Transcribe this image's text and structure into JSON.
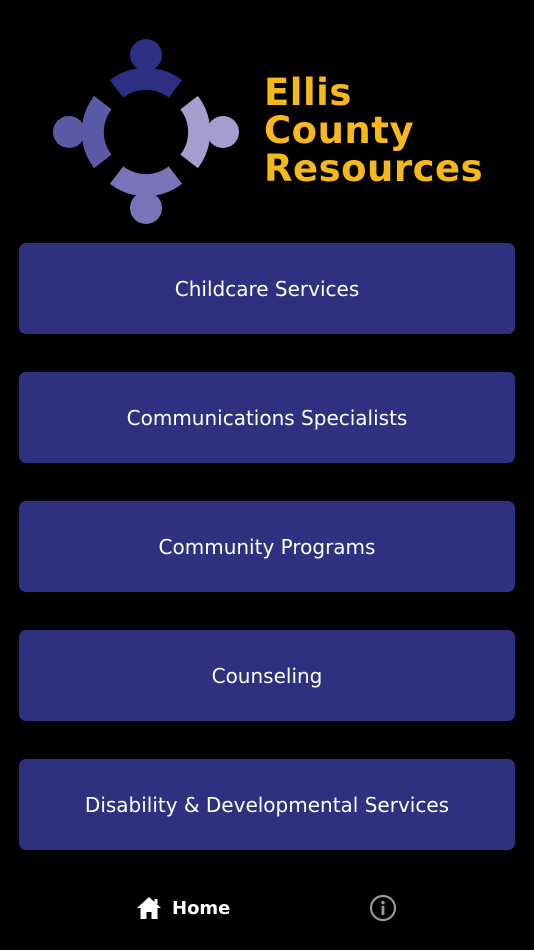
{
  "logo": {
    "line1": "Ellis",
    "line2": "County",
    "line3": "Resources",
    "text_color": "#F7B81B",
    "mark_colors": {
      "top": "#2C2F82",
      "left": "#5C5AA6",
      "right": "#A49FCF",
      "bottom": "#7B74B8"
    }
  },
  "menu": {
    "button_color": "#2E3180",
    "text_color": "#FFFFFF",
    "items": [
      {
        "label": "Childcare Services"
      },
      {
        "label": "Communications Specialists"
      },
      {
        "label": "Community Programs"
      },
      {
        "label": "Counseling"
      },
      {
        "label": "Disability & Developmental Services"
      }
    ]
  },
  "tabbar": {
    "home": {
      "label": "Home",
      "icon": "home-icon"
    },
    "info": {
      "icon": "info-icon"
    },
    "active_color": "#FFFFFF",
    "inactive_color": "#9A9A9A"
  }
}
